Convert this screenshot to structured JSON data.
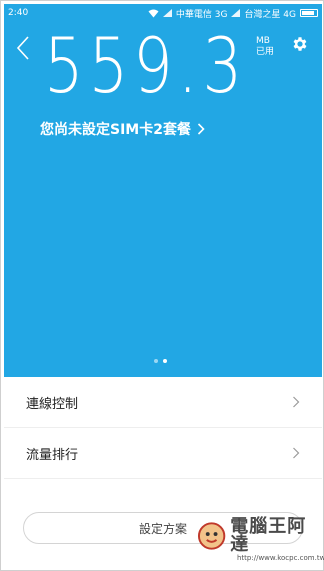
{
  "status_bar": {
    "time": "2:40",
    "carrier1": "中華電信 3G",
    "carrier2": "台灣之星 4G"
  },
  "hero": {
    "usage_value": "559.3",
    "unit": "MB",
    "unit_sub": "已用",
    "sim_prompt": "您尚未設定SIM卡2套餐",
    "page_indicator": {
      "count": 2,
      "active": 2
    }
  },
  "menu": {
    "items": [
      {
        "label": "連線控制"
      },
      {
        "label": "流量排行"
      }
    ]
  },
  "footer": {
    "plan_button_label": "設定方案",
    "watermark_text": "電腦王阿達",
    "watermark_url": "http://www.kocpc.com.tw"
  },
  "colors": {
    "accent": "#22a7e4"
  }
}
